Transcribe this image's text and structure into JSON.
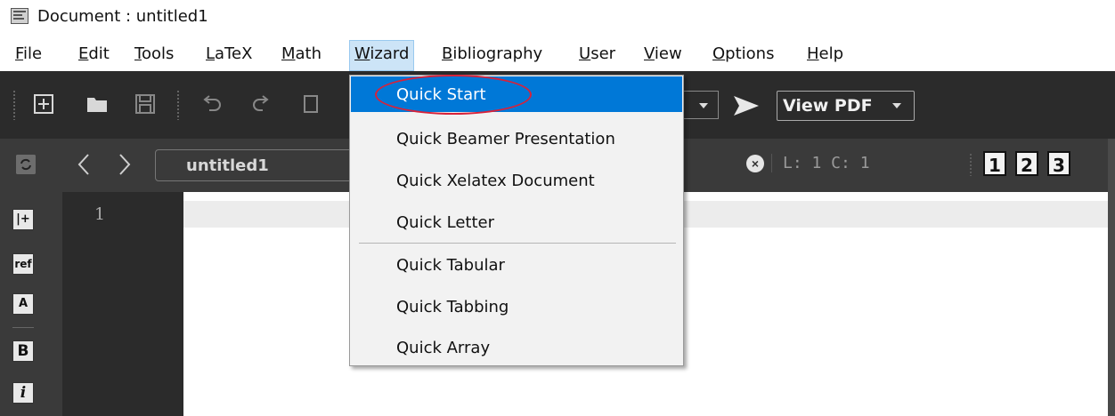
{
  "window": {
    "title": "Document : untitled1"
  },
  "menubar": {
    "items": [
      {
        "id": "file",
        "pre": "",
        "ul": "F",
        "post": "ile"
      },
      {
        "id": "edit",
        "pre": "",
        "ul": "E",
        "post": "dit"
      },
      {
        "id": "tools",
        "pre": "",
        "ul": "T",
        "post": "ools"
      },
      {
        "id": "latex",
        "pre": "",
        "ul": "L",
        "post": "aTeX"
      },
      {
        "id": "math",
        "pre": "",
        "ul": "M",
        "post": "ath"
      },
      {
        "id": "wizard",
        "pre": "",
        "ul": "W",
        "post": "izard"
      },
      {
        "id": "bibliography",
        "pre": "",
        "ul": "B",
        "post": "ibliography"
      },
      {
        "id": "user",
        "pre": "",
        "ul": "U",
        "post": "ser"
      },
      {
        "id": "view",
        "pre": "",
        "ul": "V",
        "post": "iew"
      },
      {
        "id": "options",
        "pre": "",
        "ul": "O",
        "post": "ptions"
      },
      {
        "id": "help",
        "pre": "",
        "ul": "H",
        "post": "elp"
      }
    ]
  },
  "toolbar": {
    "view_pdf_label": "View PDF"
  },
  "tabbar": {
    "document_tab": "untitled1",
    "cursor_position": "L: 1 C: 1",
    "view_buttons": [
      "1",
      "2",
      "3"
    ]
  },
  "sidebar": {
    "icons": [
      {
        "name": "insert-structure-icon",
        "glyph": "|+"
      },
      {
        "name": "ref-icon",
        "glyph": "ref"
      },
      {
        "name": "font-size-icon",
        "glyph": "A"
      },
      {
        "name": "bold-icon",
        "glyph": "B"
      },
      {
        "name": "italic-icon",
        "glyph": "i"
      }
    ]
  },
  "editor": {
    "line_numbers": [
      "1"
    ]
  },
  "wizard_menu": {
    "items": [
      {
        "label": "Quick Start",
        "active": true
      },
      {
        "label": "Quick Beamer Presentation",
        "active": false
      },
      {
        "label": "Quick Xelatex Document",
        "active": false
      },
      {
        "label": "Quick Letter",
        "active": false
      },
      {
        "label": "Quick Tabular",
        "active": false
      },
      {
        "label": "Quick Tabbing",
        "active": false
      },
      {
        "label": "Quick Array",
        "active": false
      }
    ]
  },
  "colors": {
    "menu_highlight": "#0078d7",
    "annotation_ellipse": "#d8223a",
    "toolbar_bg": "#2b2b2b"
  }
}
